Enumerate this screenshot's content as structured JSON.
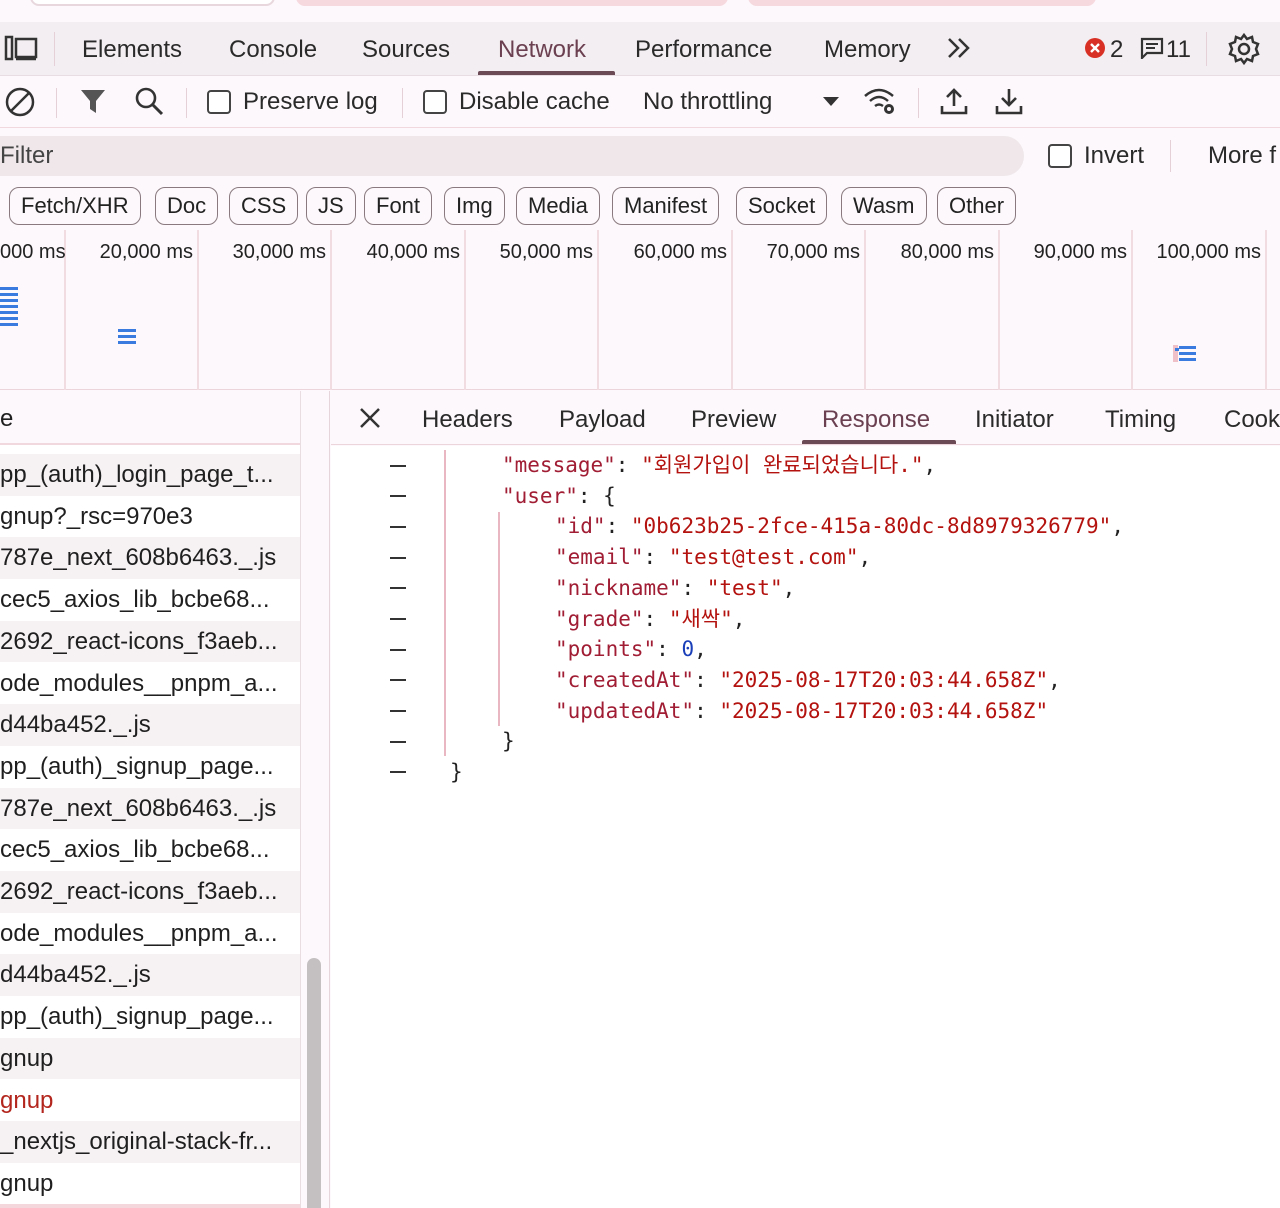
{
  "devtools_tabs": [
    {
      "label": "Elements"
    },
    {
      "label": "Console"
    },
    {
      "label": "Sources"
    },
    {
      "label": "Network",
      "active": true
    },
    {
      "label": "Performance"
    },
    {
      "label": "Memory"
    }
  ],
  "status": {
    "error_count": "2",
    "message_count": "11"
  },
  "toolbar": {
    "preserve_log_label": "Preserve log",
    "disable_cache_label": "Disable cache",
    "throttling_value": "No throttling"
  },
  "filter": {
    "placeholder": "Filter",
    "invert_label": "Invert",
    "more_filters_label": "More f"
  },
  "type_chips": [
    "Fetch/XHR",
    "Doc",
    "CSS",
    "JS",
    "Font",
    "Img",
    "Media",
    "Manifest",
    "Socket",
    "Wasm",
    "Other"
  ],
  "overview_ticks": [
    "000 ms",
    "20,000 ms",
    "30,000 ms",
    "40,000 ms",
    "50,000 ms",
    "60,000 ms",
    "70,000 ms",
    "80,000 ms",
    "90,000 ms",
    "100,000 ms"
  ],
  "request_list": {
    "header": "e",
    "rows": [
      {
        "name": "pp_(auth)_login_page_t..."
      },
      {
        "name": "gnup?_rsc=970e3"
      },
      {
        "name": "787e_next_608b6463._.js"
      },
      {
        "name": "cec5_axios_lib_bcbe68..."
      },
      {
        "name": "2692_react-icons_f3aeb..."
      },
      {
        "name": "ode_modules__pnpm_a..."
      },
      {
        "name": "d44ba452._.js"
      },
      {
        "name": "pp_(auth)_signup_page..."
      },
      {
        "name": "787e_next_608b6463._.js"
      },
      {
        "name": "cec5_axios_lib_bcbe68..."
      },
      {
        "name": "2692_react-icons_f3aeb..."
      },
      {
        "name": "ode_modules__pnpm_a..."
      },
      {
        "name": "d44ba452._.js"
      },
      {
        "name": "pp_(auth)_signup_page..."
      },
      {
        "name": "gnup"
      },
      {
        "name": "gnup",
        "error": true
      },
      {
        "name": "_nextjs_original-stack-fr..."
      },
      {
        "name": "gnup"
      }
    ]
  },
  "detail_tabs": [
    {
      "label": "Headers"
    },
    {
      "label": "Payload"
    },
    {
      "label": "Preview"
    },
    {
      "label": "Response",
      "active": true
    },
    {
      "label": "Initiator"
    },
    {
      "label": "Timing"
    },
    {
      "label": "Cook"
    }
  ],
  "response": {
    "message_key": "\"message\"",
    "message_value": "\"회원가입이 완료되었습니다.\"",
    "user_key": "\"user\"",
    "fields": [
      {
        "key": "\"id\"",
        "value": "\"0b623b25-2fce-415a-80dc-8d8979326779\"",
        "type": "string",
        "comma": ","
      },
      {
        "key": "\"email\"",
        "value": "\"test@test.com\"",
        "type": "string",
        "comma": ","
      },
      {
        "key": "\"nickname\"",
        "value": "\"test\"",
        "type": "string",
        "comma": ","
      },
      {
        "key": "\"grade\"",
        "value": "\"새싹\"",
        "type": "string",
        "comma": ","
      },
      {
        "key": "\"points\"",
        "value": "0",
        "type": "number",
        "comma": ","
      },
      {
        "key": "\"createdAt\"",
        "value": "\"2025-08-17T20:03:44.658Z\"",
        "type": "string",
        "comma": ","
      },
      {
        "key": "\"updatedAt\"",
        "value": "\"2025-08-17T20:03:44.658Z\"",
        "type": "string",
        "comma": ""
      }
    ]
  },
  "colors": {
    "accent": "#6b4a55",
    "error_red": "#d93025",
    "json_key": "#a01d34",
    "json_string": "#b3120e",
    "json_number": "#1a3fb8"
  }
}
